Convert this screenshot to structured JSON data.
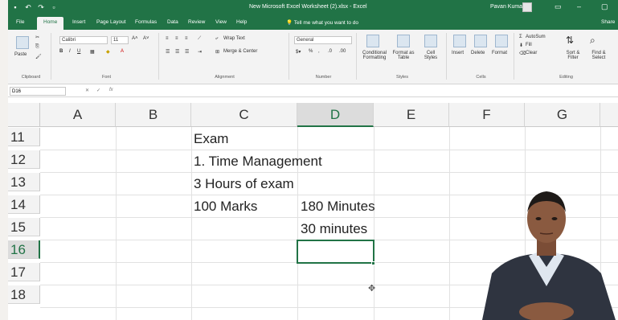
{
  "window": {
    "title": "New Microsoft Excel Worksheet (2).xlsx - Excel",
    "user": "Pavan Kumar"
  },
  "ribbon": {
    "tabs": [
      "File",
      "Home",
      "Insert",
      "Page Layout",
      "Formulas",
      "Data",
      "Review",
      "View",
      "Help"
    ],
    "active_tab": "Home",
    "tell_me": "Tell me what you want to do",
    "share": "Share",
    "clipboard": {
      "paste": "Paste",
      "label": "Clipboard"
    },
    "font": {
      "name": "Calibri",
      "size": "11",
      "label": "Font"
    },
    "alignment": {
      "wrap": "Wrap Text",
      "merge": "Merge & Center",
      "label": "Alignment"
    },
    "number": {
      "format": "General",
      "label": "Number"
    },
    "styles": {
      "conditional": "Conditional Formatting",
      "format_table": "Format as Table",
      "cell_styles": "Cell Styles",
      "label": "Styles"
    },
    "cells": {
      "insert": "Insert",
      "delete": "Delete",
      "format": "Format",
      "label": "Cells"
    },
    "editing": {
      "autosum": "AutoSum",
      "fill": "Fill",
      "clear": "Clear",
      "sort": "Sort & Filter",
      "find": "Find & Select",
      "label": "Editing"
    }
  },
  "formula_bar": {
    "name_box": "D16",
    "fx": "fx"
  },
  "sheet": {
    "columns": [
      "A",
      "B",
      "C",
      "D",
      "E",
      "F",
      "G"
    ],
    "selected_column": "D",
    "rows": [
      "11",
      "12",
      "13",
      "14",
      "15",
      "16",
      "17",
      "18"
    ],
    "selected_row": "16",
    "cells": {
      "C11": "Exam",
      "C12": "1. Time Management",
      "C13": "3 Hours of exam",
      "C14": "100 Marks",
      "D14": "180 Minutes",
      "D15": "30 minutes"
    }
  },
  "colors": {
    "excel_green": "#217346",
    "header_gray": "#f3f3f3"
  }
}
